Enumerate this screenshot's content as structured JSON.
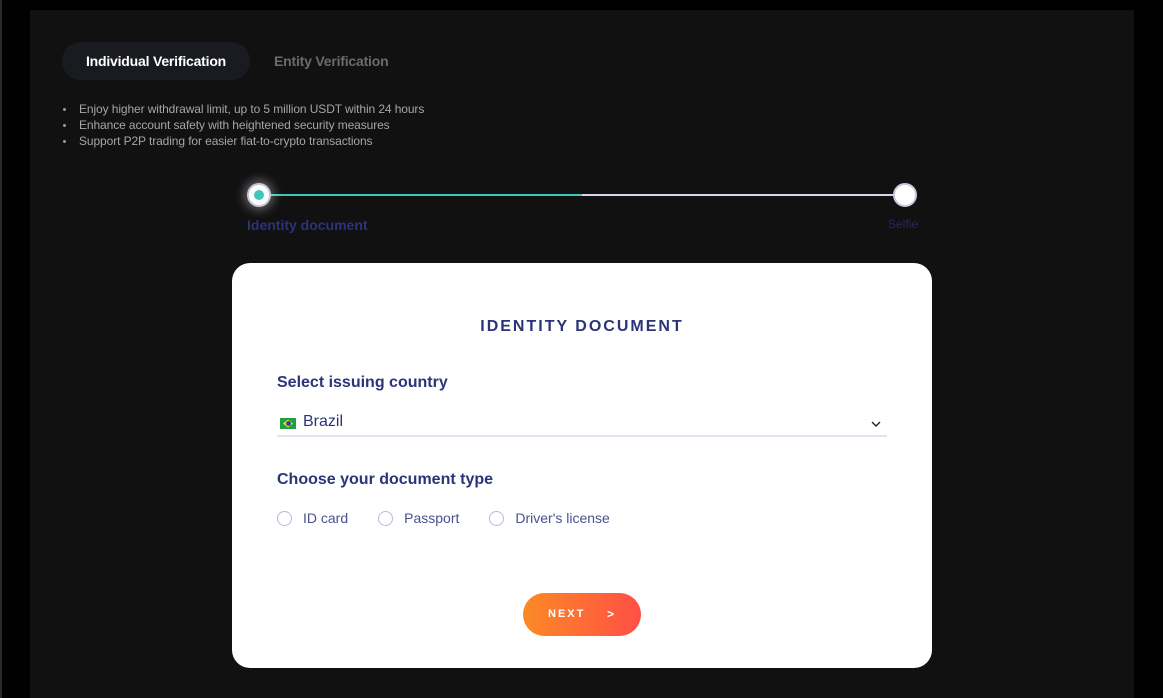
{
  "tabs": [
    {
      "label": "Individual Verification",
      "active": true
    },
    {
      "label": "Entity Verification",
      "active": false
    }
  ],
  "benefits": [
    "Enjoy higher withdrawal limit, up to 5 million USDT within 24 hours",
    "Enhance account safety with heightened security measures",
    "Support P2P trading for easier fiat-to-crypto transactions"
  ],
  "stepper": {
    "progress": 0.5,
    "steps": [
      {
        "label": "Identity document",
        "status": "current"
      },
      {
        "label": "Selfie",
        "status": "upcoming"
      }
    ]
  },
  "card": {
    "title": "IDENTITY DOCUMENT",
    "country_label": "Select issuing country",
    "country": {
      "value": "Brazil",
      "flag_icon": "brazil-flag-icon"
    },
    "doctype_label": "Choose your document type",
    "doctype_options": [
      {
        "label": "ID card",
        "selected": false
      },
      {
        "label": "Passport",
        "selected": false
      },
      {
        "label": "Driver's license",
        "selected": false
      }
    ],
    "next_label": "NEXT",
    "next_arrow": ">"
  },
  "colors": {
    "accent_teal": "#3fc6be",
    "brand_navy": "#2b3478",
    "button_gradient_start": "#fb8a25",
    "button_gradient_end": "#ff4f45"
  }
}
